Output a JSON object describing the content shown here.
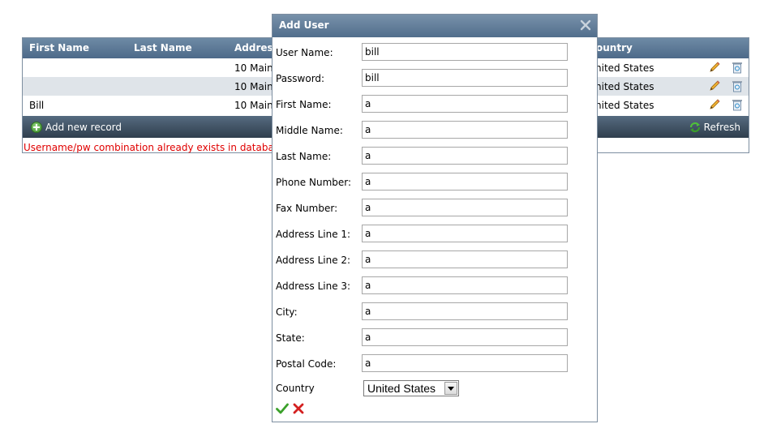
{
  "grid": {
    "columns": {
      "first_name": "First Name",
      "last_name": "Last Name",
      "address": "Address",
      "country": "ountry"
    },
    "rows": [
      {
        "first_name": "",
        "address": "10 Main",
        "country": "nited States"
      },
      {
        "first_name": "",
        "address": "10 Main",
        "country": "nited States"
      },
      {
        "first_name": "Bill",
        "address": "10 Main",
        "country": "nited States"
      }
    ],
    "footer": {
      "add_label": "Add new record",
      "refresh_label": "Refresh"
    },
    "error_message": "Username/pw combination already exists in database"
  },
  "dialog": {
    "title": "Add User",
    "fields": [
      {
        "label": "User Name:",
        "value": "bill"
      },
      {
        "label": "Password:",
        "value": "bill"
      },
      {
        "label": "First Name:",
        "value": "a"
      },
      {
        "label": "Middle Name:",
        "value": "a"
      },
      {
        "label": "Last Name:",
        "value": "a"
      },
      {
        "label": "Phone Number:",
        "value": "a"
      },
      {
        "label": "Fax Number:",
        "value": "a"
      },
      {
        "label": "Address Line 1:",
        "value": "a"
      },
      {
        "label": "Address Line 2:",
        "value": "a"
      },
      {
        "label": "Address Line 3:",
        "value": "a"
      },
      {
        "label": "City:",
        "value": "a"
      },
      {
        "label": "State:",
        "value": "a"
      },
      {
        "label": "Postal Code:",
        "value": "a"
      }
    ],
    "country": {
      "label": "Country",
      "value": "United States"
    }
  },
  "icons": {
    "edit": "pencil-icon",
    "delete": "recycle-bin-icon",
    "add": "plus-circle-icon",
    "refresh": "refresh-icon",
    "close": "close-icon",
    "confirm": "checkmark-icon",
    "cancel": "cross-icon"
  },
  "colors": {
    "header_bg": "#5f7c99",
    "footer_bg": "#3a4a5a",
    "alt_row": "#dfe4e9",
    "error": "#e00000",
    "confirm": "#3aa02a",
    "cancel": "#d42020"
  }
}
